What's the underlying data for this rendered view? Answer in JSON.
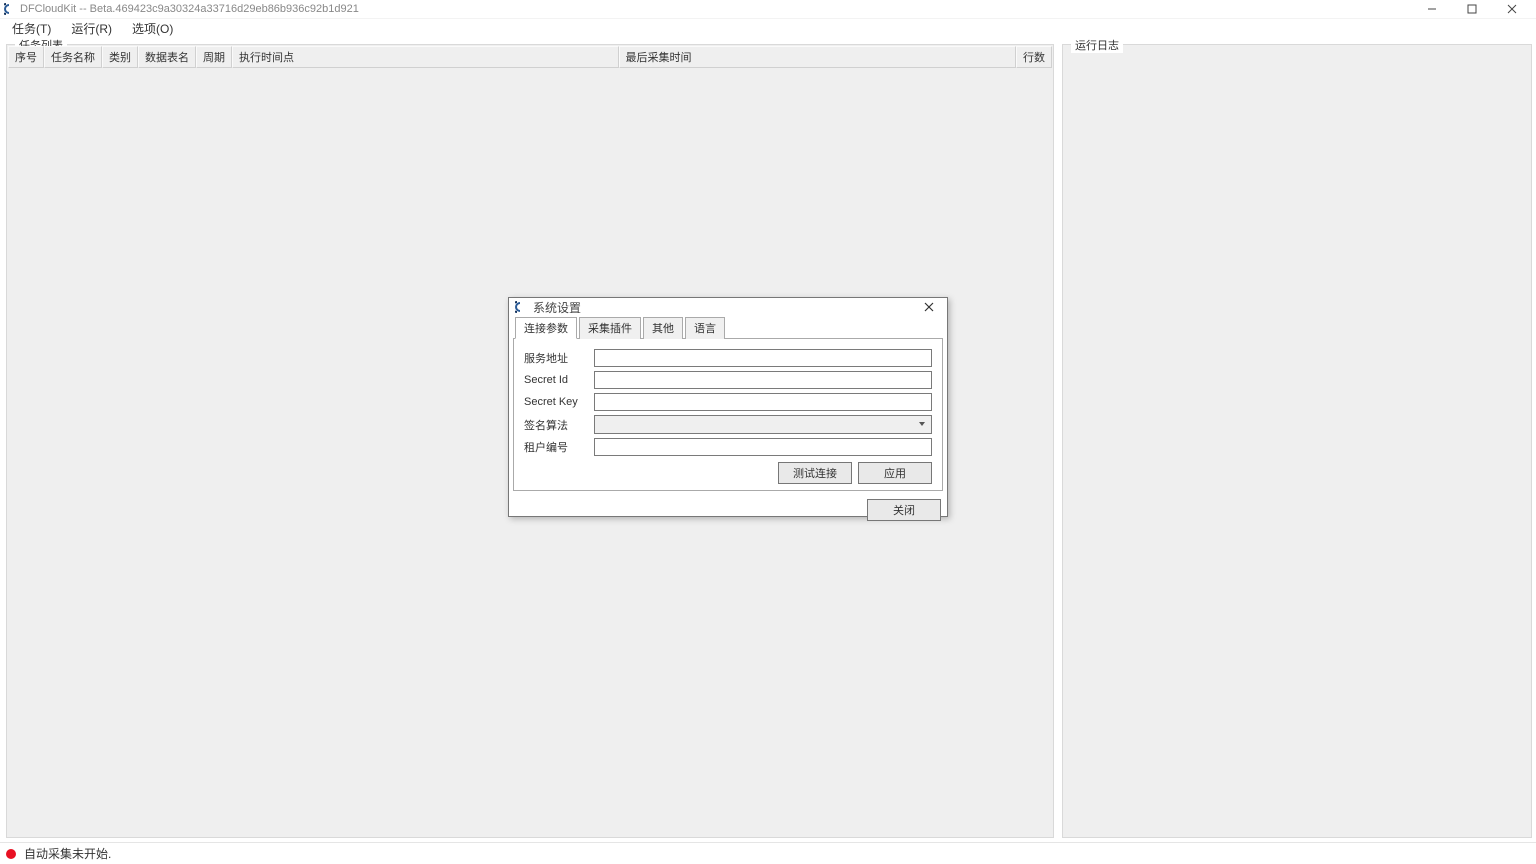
{
  "window": {
    "title": "DFCloudKit -- Beta.469423c9a30324a33716d29eb86b936c92b1d921"
  },
  "menu": {
    "tasks": "任务(T)",
    "run": "运行(R)",
    "options": "选项(O)"
  },
  "panels": {
    "task_list": "任务列表",
    "run_log": "运行日志"
  },
  "table": {
    "col_index": "序号",
    "col_name": "任务名称",
    "col_category": "类别",
    "col_table": "数据表名",
    "col_period": "周期",
    "col_exec_time": "执行时间点",
    "col_last_collect": "最后采集时间",
    "col_rows": "行数"
  },
  "status": {
    "text": "自动采集未开始."
  },
  "dialog": {
    "title": "系统设置",
    "tabs": {
      "connection": "连接参数",
      "plugins": "采集插件",
      "other": "其他",
      "language": "语言"
    },
    "fields": {
      "service_addr": "服务地址",
      "secret_id": "Secret Id",
      "secret_key": "Secret Key",
      "sign_algo": "签名算法",
      "tenant_id": "租户编号"
    },
    "values": {
      "service_addr": "",
      "secret_id": "",
      "secret_key": "",
      "sign_algo": "",
      "tenant_id": ""
    },
    "buttons": {
      "test": "测试连接",
      "apply": "应用",
      "close": "关闭"
    }
  }
}
